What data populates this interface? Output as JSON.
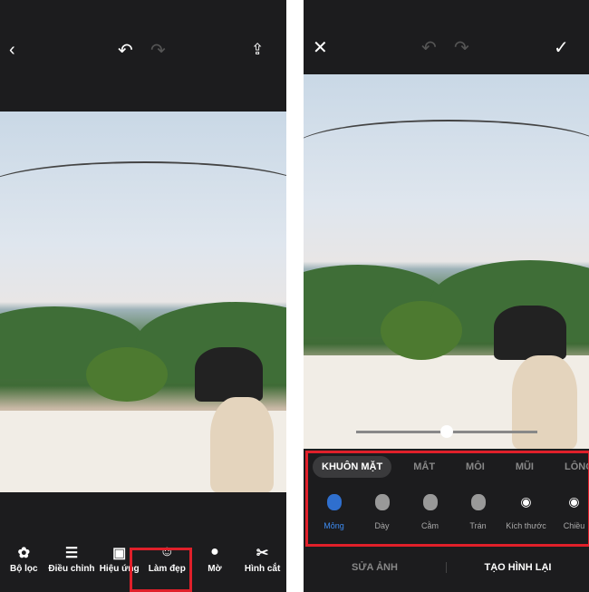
{
  "left": {
    "icons": {
      "back": "chevron-left-icon",
      "undo": "undo-icon",
      "redo": "redo-icon",
      "share": "share-icon"
    },
    "tools": [
      {
        "label": "Bộ lọc",
        "icon": "filter-icon"
      },
      {
        "label": "Điều chỉnh",
        "icon": "sliders-icon"
      },
      {
        "label": "Hiệu ứng",
        "icon": "effects-icon"
      },
      {
        "label": "Làm đẹp",
        "icon": "face-beauty-icon",
        "highlighted": true
      },
      {
        "label": "Mờ",
        "icon": "drop-icon"
      },
      {
        "label": "Hình cắt",
        "icon": "scissors-icon"
      }
    ]
  },
  "right": {
    "icons": {
      "close": "close-icon",
      "undo": "undo-icon",
      "redo": "redo-icon",
      "confirm": "check-icon"
    },
    "slider_value": 0.5,
    "tabs": [
      "KHUÔN MẶT",
      "MẮT",
      "MÔI",
      "MŨI",
      "LÔNG MÀY"
    ],
    "active_tab": "KHUÔN MẶT",
    "features": [
      "Mỏng",
      "Dày",
      "Cằm",
      "Trán",
      "Kích thước",
      "Chiều"
    ],
    "active_feature": "Mỏng",
    "bottom_tabs": [
      "SỬA ẢNH",
      "TẠO HÌNH LẠI"
    ],
    "active_bottom_tab": "TẠO HÌNH LẠI"
  },
  "colors": {
    "highlight": "#e0202a",
    "accent": "#3d8bf0",
    "background": "#1c1c1e"
  }
}
